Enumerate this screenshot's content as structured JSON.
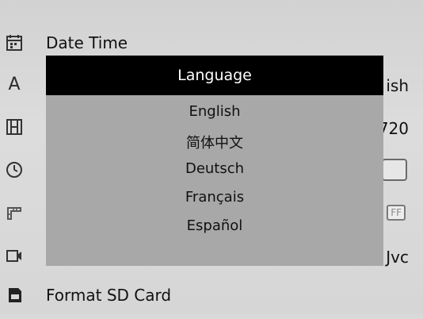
{
  "menu": {
    "date_time": "Date Time",
    "language_value": "ish",
    "resolution_value": "720",
    "motion_value": "FF",
    "video_value": "Jvc",
    "format_sd": "Format SD Card"
  },
  "dialog": {
    "title": "Language",
    "options": [
      "English",
      "简体中文",
      "Deutsch",
      "Français",
      "Español"
    ]
  },
  "icons": [
    "calendar-icon",
    "language-icon",
    "film-icon",
    "clock-icon",
    "ruler-icon",
    "video-icon",
    "sd-card-icon"
  ]
}
